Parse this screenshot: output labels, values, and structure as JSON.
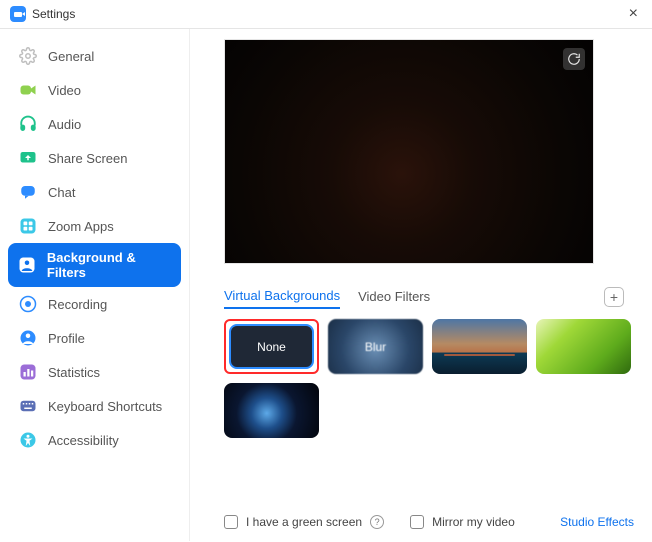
{
  "window": {
    "title": "Settings"
  },
  "sidebar": {
    "items": [
      {
        "label": "General"
      },
      {
        "label": "Video"
      },
      {
        "label": "Audio"
      },
      {
        "label": "Share Screen"
      },
      {
        "label": "Chat"
      },
      {
        "label": "Zoom Apps"
      },
      {
        "label": "Background & Filters"
      },
      {
        "label": "Recording"
      },
      {
        "label": "Profile"
      },
      {
        "label": "Statistics"
      },
      {
        "label": "Keyboard Shortcuts"
      },
      {
        "label": "Accessibility"
      }
    ],
    "active_index": 6
  },
  "tabs": {
    "virtual_backgrounds": "Virtual Backgrounds",
    "video_filters": "Video Filters",
    "active": "virtual_backgrounds"
  },
  "backgrounds": {
    "none_label": "None",
    "blur_label": "Blur",
    "selected_index": 0
  },
  "footer": {
    "green_screen": "I have a green screen",
    "mirror": "Mirror my video",
    "studio_effects": "Studio Effects"
  }
}
